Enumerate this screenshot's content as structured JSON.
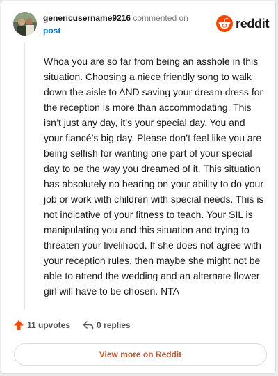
{
  "header": {
    "username": "genericusername9216",
    "action_text": "commented on",
    "post_link": "post"
  },
  "logo": {
    "icon": "reddit-snoo-icon",
    "text": "reddit"
  },
  "comment": {
    "body": "Whoa you are so far from being an asshole in this situation. Choosing a niece friendly song to walk down the aisle to AND saving your dream dress for the reception is more than accommodating. This isn’t just any day, it’s your special day. You and your fiancé’s big day. Please don’t feel like you are being selfish for wanting one part of your special day to be the way you dreamed of it. This situation has absolutely no bearing on your ability to do your job or work with children with special needs. This is not indicative of your fitness to teach. Your SIL is manipulating you and this situation and trying to threaten your livelihood. If she does not agree with your reception rules, then maybe she might not be able to attend the wedding and an alternate flower girl will have to be chosen. NTA"
  },
  "actions": {
    "upvotes": "11 upvotes",
    "upvote_icon": "upvote-arrow-icon",
    "replies": "0 replies",
    "reply_icon": "reply-arrow-icon"
  },
  "footer": {
    "view_more": "View more on Reddit"
  },
  "colors": {
    "accent": "#ff4500",
    "link": "#0079d3",
    "button_text": "#c6572f"
  }
}
